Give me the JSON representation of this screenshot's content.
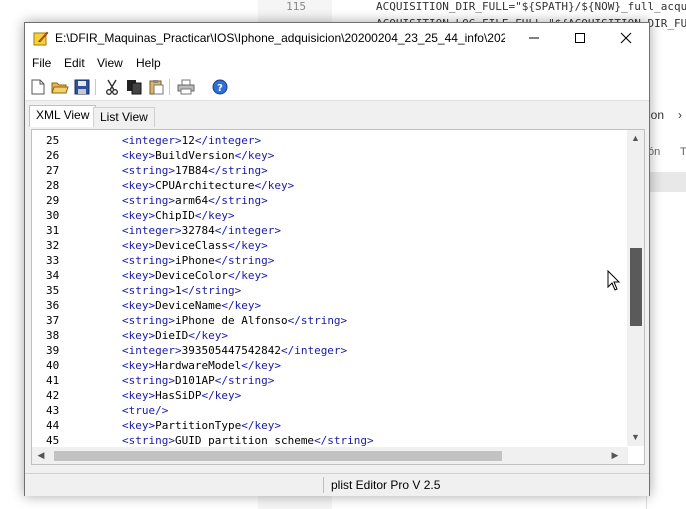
{
  "background_editor": {
    "lines": [
      {
        "num": "115",
        "code": "ACQUISITION_DIR_FULL=\"${SPATH}/${NOW}_full_acqui"
      },
      {
        "num": "",
        "code": "ACQUISITION_LOG_FILE_FULL=\"${ACQUISITION_DIR_FUL"
      }
    ],
    "panel_tab": "ion",
    "panel_rows": [
      "ón",
      "T"
    ]
  },
  "window": {
    "title": "E:\\DFIR_Maquinas_Practicar\\IOS\\Iphone_adquisicion\\20200204_23_25_44_info\\20200..."
  },
  "menu": {
    "items": [
      "File",
      "Edit",
      "View",
      "Help"
    ]
  },
  "tabs": {
    "xml_view": "XML View",
    "list_view": "List View"
  },
  "xml_lines": [
    {
      "num": "25",
      "open": "<integer>",
      "text": "12",
      "close": "</integer>"
    },
    {
      "num": "26",
      "open": "<key>",
      "text": "BuildVersion",
      "close": "</key>"
    },
    {
      "num": "27",
      "open": "<string>",
      "text": "17B84",
      "close": "</string>"
    },
    {
      "num": "28",
      "open": "<key>",
      "text": "CPUArchitecture",
      "close": "</key>"
    },
    {
      "num": "29",
      "open": "<string>",
      "text": "arm64",
      "close": "</string>"
    },
    {
      "num": "30",
      "open": "<key>",
      "text": "ChipID",
      "close": "</key>"
    },
    {
      "num": "31",
      "open": "<integer>",
      "text": "32784",
      "close": "</integer>"
    },
    {
      "num": "32",
      "open": "<key>",
      "text": "DeviceClass",
      "close": "</key>"
    },
    {
      "num": "33",
      "open": "<string>",
      "text": "iPhone",
      "close": "</string>"
    },
    {
      "num": "34",
      "open": "<key>",
      "text": "DeviceColor",
      "close": "</key>"
    },
    {
      "num": "35",
      "open": "<string>",
      "text": "1",
      "close": "</string>"
    },
    {
      "num": "36",
      "open": "<key>",
      "text": "DeviceName",
      "close": "</key>"
    },
    {
      "num": "37",
      "open": "<string>",
      "text": "iPhone de Alfonso",
      "close": "</string>"
    },
    {
      "num": "38",
      "open": "<key>",
      "text": "DieID",
      "close": "</key>"
    },
    {
      "num": "39",
      "open": "<integer>",
      "text": "393505447542842",
      "close": "</integer>"
    },
    {
      "num": "40",
      "open": "<key>",
      "text": "HardwareModel",
      "close": "</key>"
    },
    {
      "num": "41",
      "open": "<string>",
      "text": "D101AP",
      "close": "</string>"
    },
    {
      "num": "42",
      "open": "<key>",
      "text": "HasSiDP",
      "close": "</key>"
    },
    {
      "num": "43",
      "open": "<true/>",
      "text": "",
      "close": ""
    },
    {
      "num": "44",
      "open": "<key>",
      "text": "PartitionType",
      "close": "</key>"
    },
    {
      "num": "45",
      "open": "<string>",
      "text": "GUID_partition_scheme",
      "close": "</string>"
    }
  ],
  "status": {
    "text": "plist Editor Pro V 2.5"
  },
  "colors": {
    "tag": "#1a1aa6",
    "scroll_thumb": "#5a5a5a"
  }
}
